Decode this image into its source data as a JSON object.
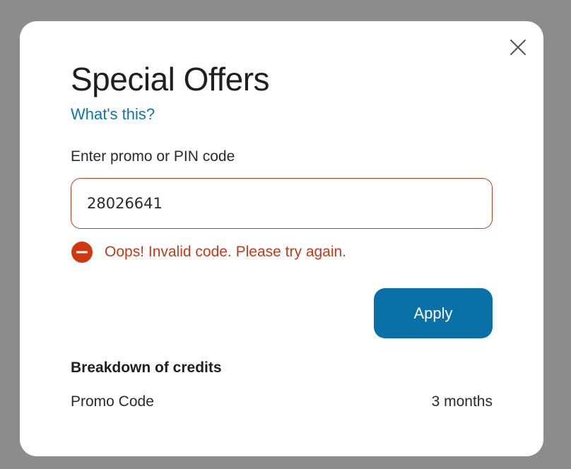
{
  "modal": {
    "title": "Special Offers",
    "help_link": "What's this?",
    "close_icon": "close-icon",
    "field_label": "Enter promo or PIN code",
    "code_value": "28026641",
    "error": {
      "icon": "error-minus-circle-icon",
      "message": "Oops! Invalid code. Please try again."
    },
    "apply_label": "Apply",
    "breakdown": {
      "title": "Breakdown of credits",
      "rows": [
        {
          "label": "Promo Code",
          "value": "3 months"
        }
      ]
    }
  },
  "colors": {
    "overlay": "#8c8c8c",
    "accent": "#0a71a8",
    "link": "#0d76a8",
    "error": "#c53a1a"
  }
}
